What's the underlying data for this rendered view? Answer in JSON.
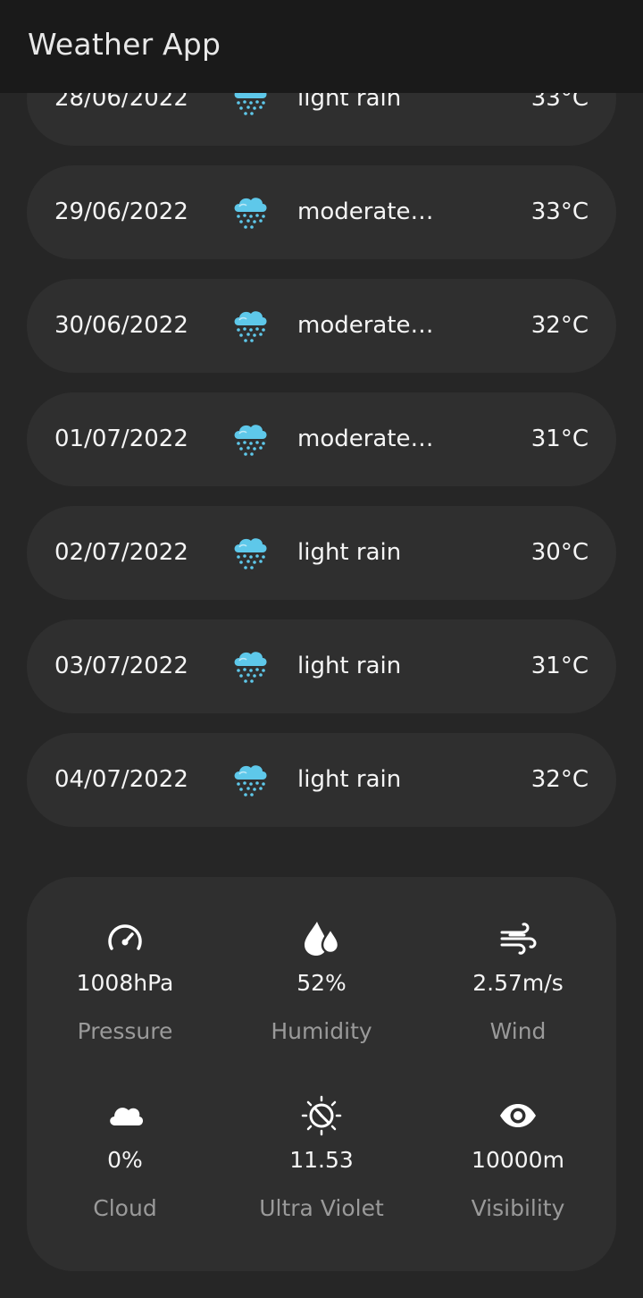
{
  "app": {
    "title": "Weather App"
  },
  "forecast": [
    {
      "date": "28/06/2022",
      "icon": "rain-cloud-icon",
      "description": "light rain",
      "temp": "33°C"
    },
    {
      "date": "29/06/2022",
      "icon": "rain-cloud-icon",
      "description": "moderate rain",
      "temp": "33°C"
    },
    {
      "date": "30/06/2022",
      "icon": "rain-cloud-icon",
      "description": "moderate rain",
      "temp": "32°C"
    },
    {
      "date": "01/07/2022",
      "icon": "rain-cloud-icon",
      "description": "moderate rain",
      "temp": "31°C"
    },
    {
      "date": "02/07/2022",
      "icon": "rain-cloud-icon",
      "description": "light rain",
      "temp": "30°C"
    },
    {
      "date": "03/07/2022",
      "icon": "rain-cloud-icon",
      "description": "light rain",
      "temp": "31°C"
    },
    {
      "date": "04/07/2022",
      "icon": "rain-cloud-icon",
      "description": "light rain",
      "temp": "32°C"
    }
  ],
  "details": {
    "pressure": {
      "icon": "gauge-icon",
      "value": "1008hPa",
      "label": "Pressure"
    },
    "humidity": {
      "icon": "water-drops-icon",
      "value": "52%",
      "label": "Humidity"
    },
    "wind": {
      "icon": "wind-icon",
      "value": "2.57m/s",
      "label": "Wind"
    },
    "cloud": {
      "icon": "cloud-icon",
      "value": "0%",
      "label": "Cloud"
    },
    "uv": {
      "icon": "uv-sun-icon",
      "value": "11.53",
      "label": "Ultra Violet"
    },
    "visibility": {
      "icon": "eye-icon",
      "value": "10000m",
      "label": "Visibility"
    }
  },
  "colors": {
    "background": "#262626",
    "card": "#2f2f2f",
    "appbar": "#1a1a1a",
    "rain_icon": "#5ec8ea",
    "label": "#9a9a9a"
  }
}
